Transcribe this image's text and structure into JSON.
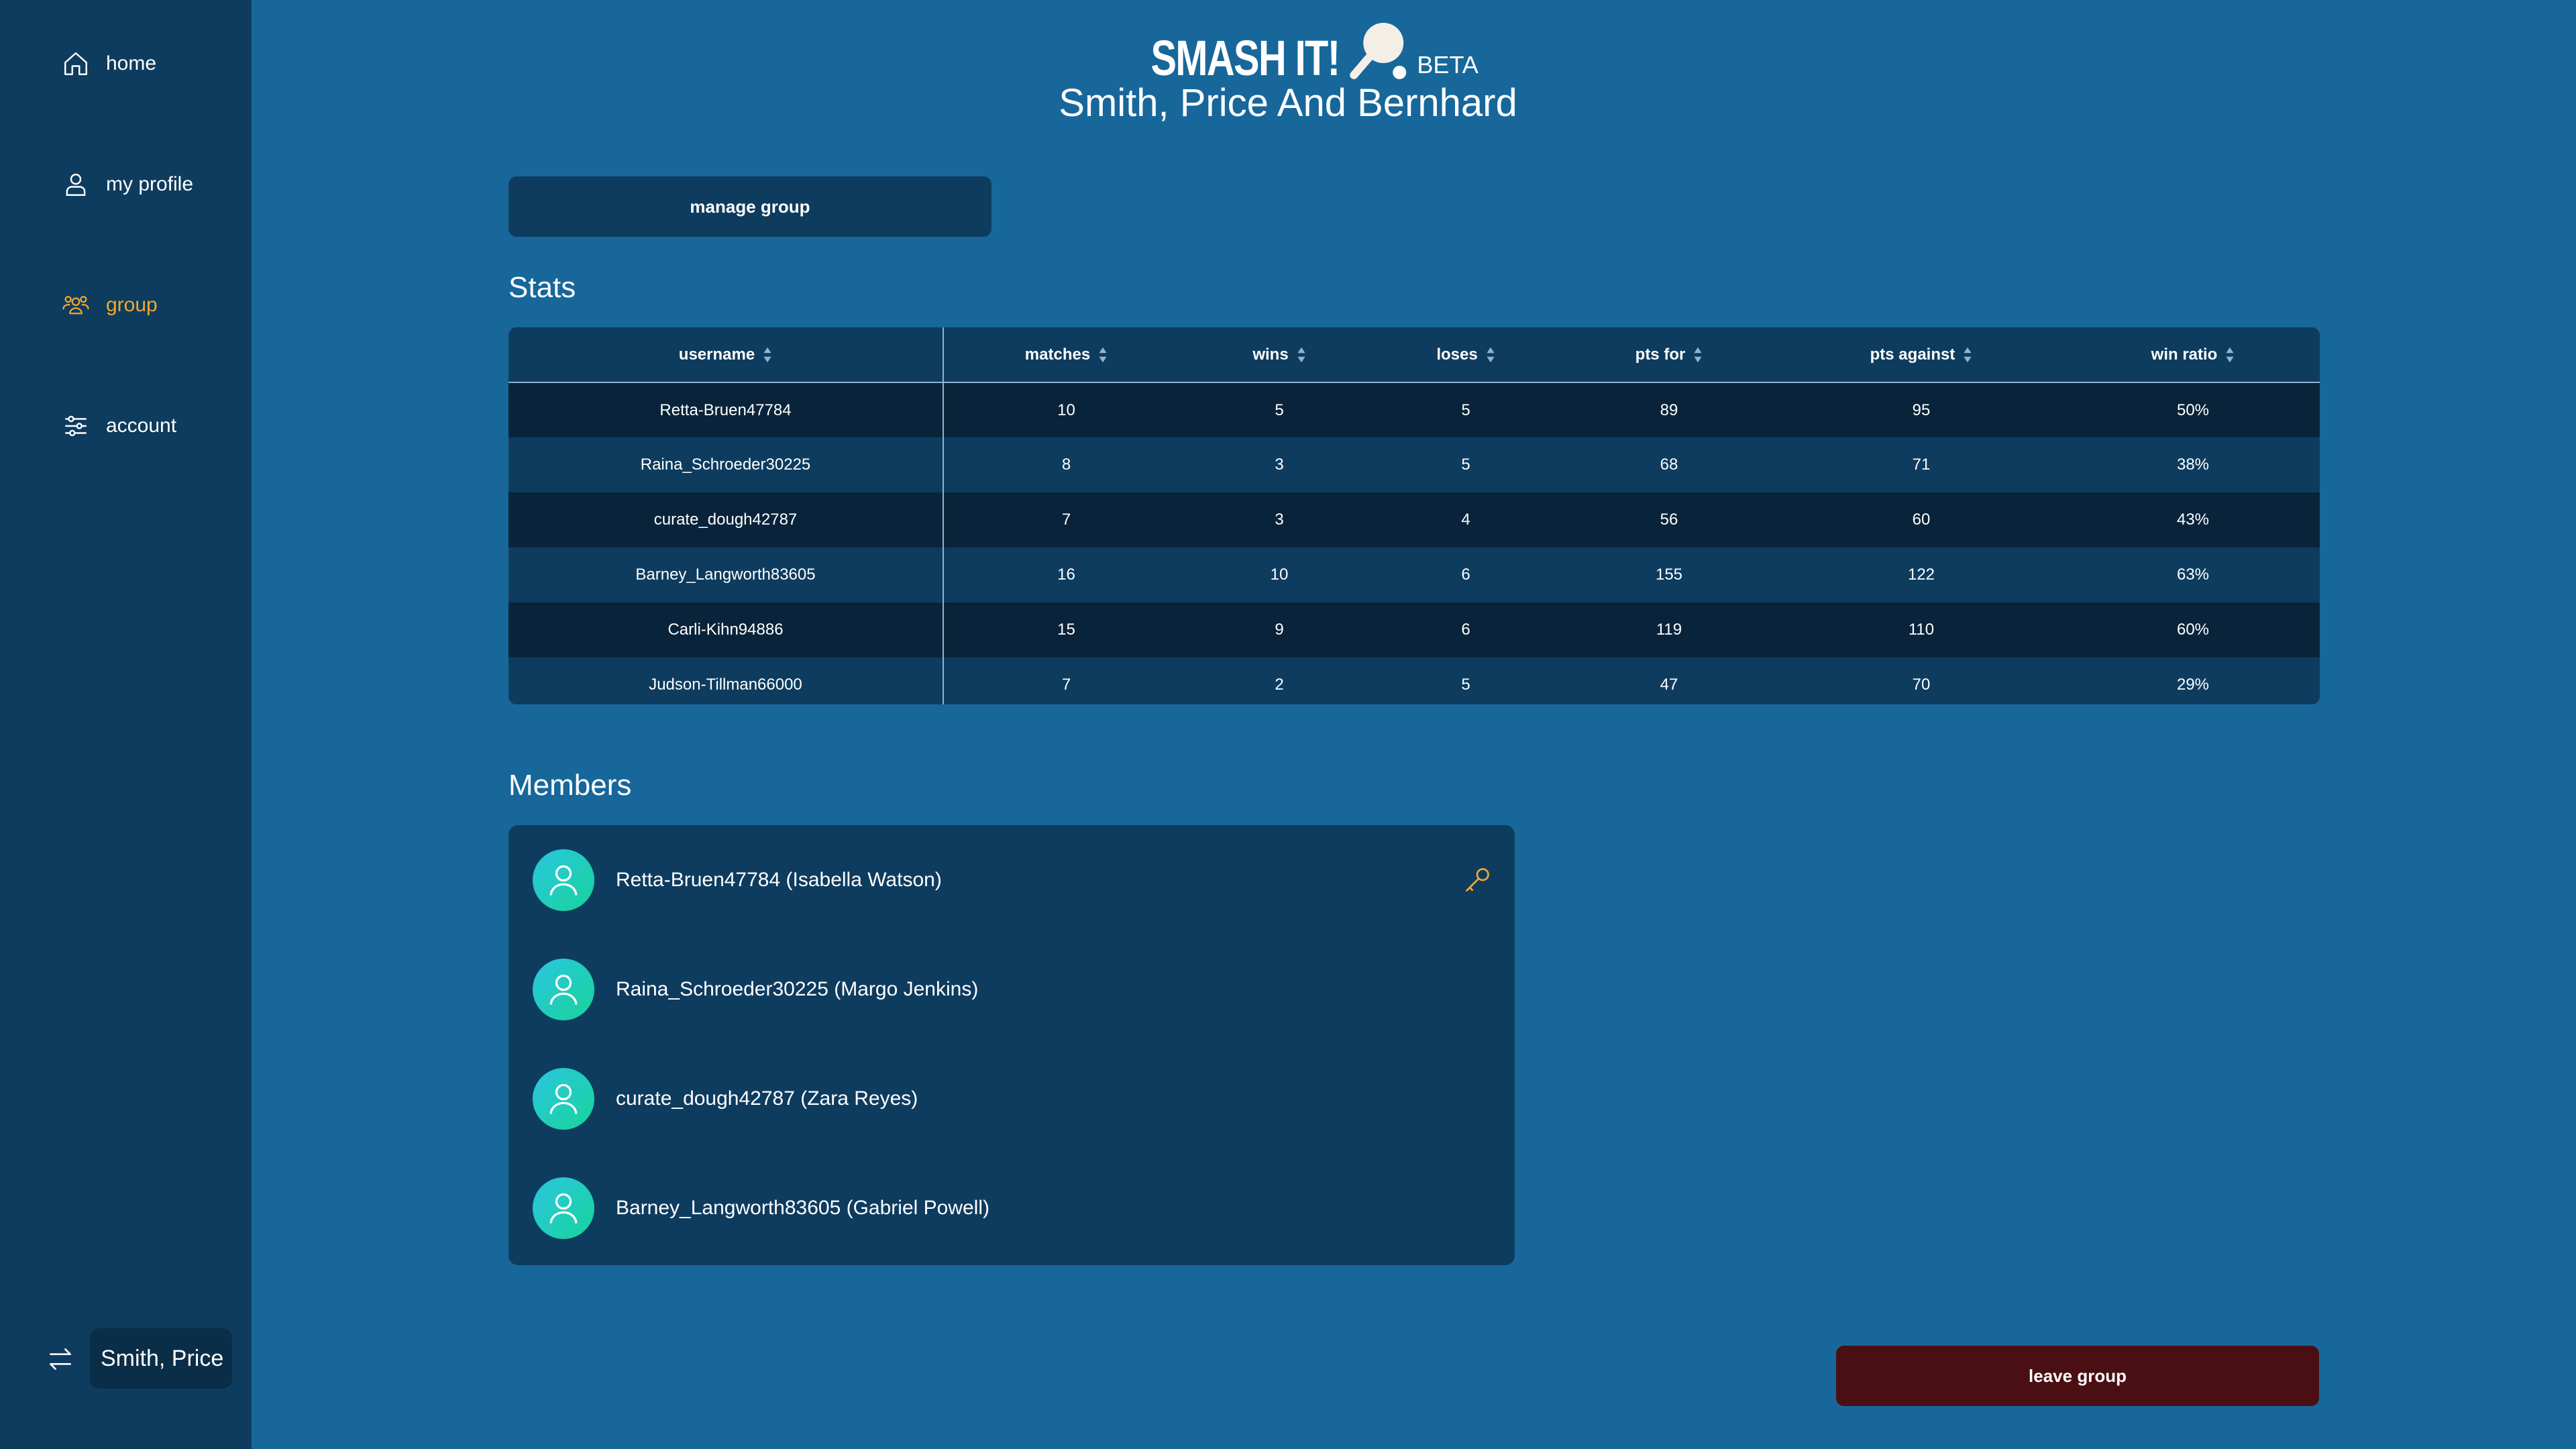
{
  "sidebar": {
    "items": [
      {
        "label": "home",
        "icon": "home-icon"
      },
      {
        "label": "my profile",
        "icon": "user-icon"
      },
      {
        "label": "group",
        "icon": "group-icon",
        "active": true
      },
      {
        "label": "account",
        "icon": "sliders-icon"
      }
    ],
    "current_group": "Smith, Price",
    "switch_icon": "switch-icon"
  },
  "header": {
    "logo_text": "SMASH IT!",
    "beta_label": "BETA",
    "group_name": "Smith, Price And Bernhard"
  },
  "actions": {
    "manage_label": "manage group",
    "leave_label": "leave group"
  },
  "stats": {
    "heading": "Stats",
    "columns": [
      "username",
      "matches",
      "wins",
      "loses",
      "pts for",
      "pts against",
      "win ratio"
    ],
    "rows": [
      [
        "Retta-Bruen47784",
        "10",
        "5",
        "5",
        "89",
        "95",
        "50%"
      ],
      [
        "Raina_Schroeder30225",
        "8",
        "3",
        "5",
        "68",
        "71",
        "38%"
      ],
      [
        "curate_dough42787",
        "7",
        "3",
        "4",
        "56",
        "60",
        "43%"
      ],
      [
        "Barney_Langworth83605",
        "16",
        "10",
        "6",
        "155",
        "122",
        "63%"
      ],
      [
        "Carli-Kihn94886",
        "15",
        "9",
        "6",
        "119",
        "110",
        "60%"
      ],
      [
        "Judson-Tillman66000",
        "7",
        "2",
        "5",
        "47",
        "70",
        "29%"
      ]
    ]
  },
  "members": {
    "heading": "Members",
    "list": [
      {
        "label": "Retta-Bruen47784 (Isabella Watson)",
        "admin": true
      },
      {
        "label": "Raina_Schroeder30225 (Margo Jenkins)",
        "admin": false
      },
      {
        "label": "curate_dough42787 (Zara Reyes)",
        "admin": false
      },
      {
        "label": "Barney_Langworth83605 (Gabriel Powell)",
        "admin": false
      }
    ]
  },
  "colors": {
    "background": "#17679b",
    "panel": "#0e3c5f",
    "row_dark": "#09243a",
    "accent": "#f0a830",
    "danger": "#4a0f12"
  }
}
